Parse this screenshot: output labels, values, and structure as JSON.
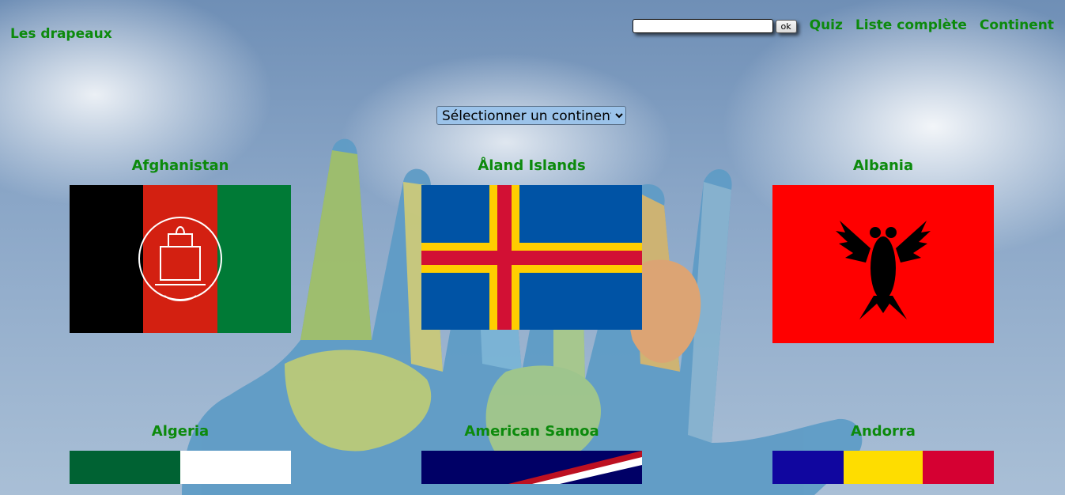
{
  "brand": "Les drapeaux",
  "search": {
    "placeholder": "",
    "value": "",
    "button_label": "ok"
  },
  "nav": [
    {
      "label": "Quiz"
    },
    {
      "label": "Liste complète"
    },
    {
      "label": "Continent"
    }
  ],
  "continent_select": {
    "selected": "Sélectionner un continent"
  },
  "countries": [
    {
      "name": "Afghanistan",
      "flag_colors": [
        "#000000",
        "#d32011",
        "#007a36"
      ]
    },
    {
      "name": "Åland Islands",
      "flag_colors": [
        "#0053a5",
        "#ffce00",
        "#d21034"
      ]
    },
    {
      "name": "Albania",
      "flag_colors": [
        "#ff0000",
        "#000000"
      ]
    },
    {
      "name": "Algeria",
      "flag_colors": [
        "#006233",
        "#ffffff",
        "#d21034"
      ]
    },
    {
      "name": "American Samoa",
      "flag_colors": [
        "#000066",
        "#ffffff",
        "#bd1021"
      ]
    },
    {
      "name": "Andorra",
      "flag_colors": [
        "#10069f",
        "#fedd00",
        "#d50032"
      ]
    }
  ],
  "colors": {
    "link_green": "#0c8a0c"
  }
}
